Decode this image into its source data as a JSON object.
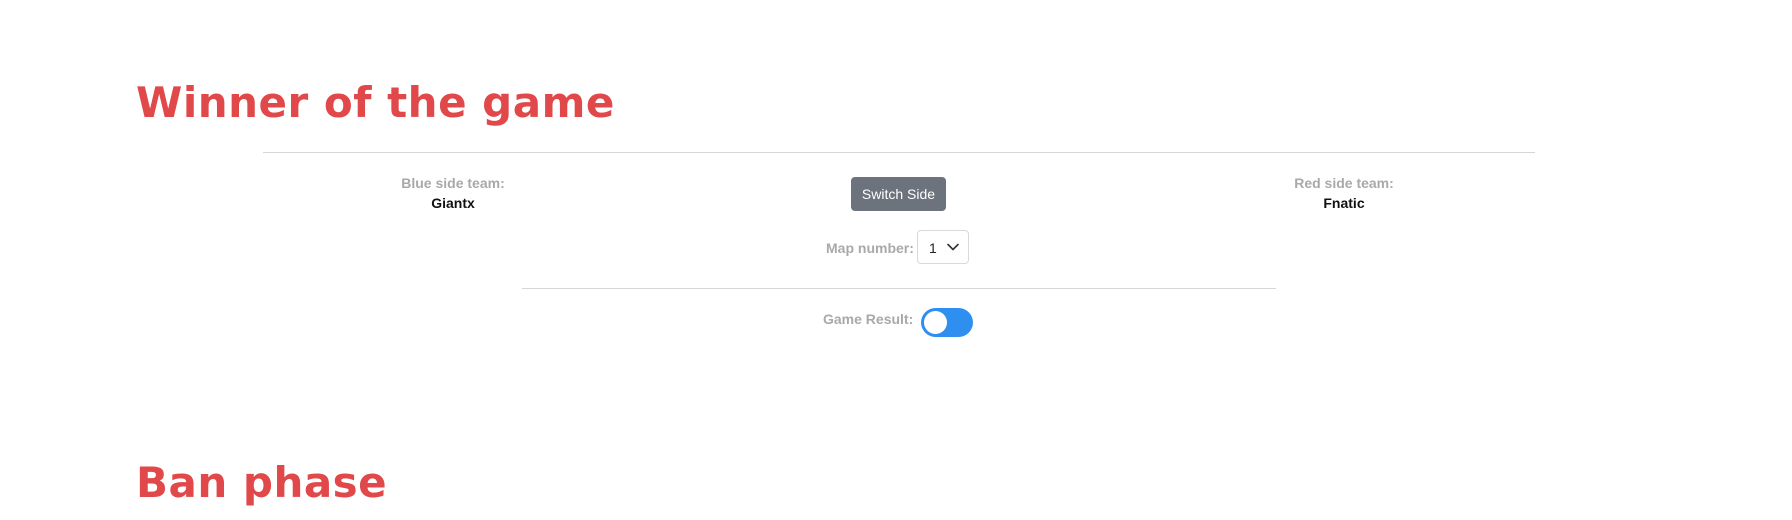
{
  "sections": {
    "winner_title": "Winner of the game",
    "ban_title": "Ban phase"
  },
  "teams": {
    "blue_label": "Blue side team:",
    "blue_name": "Giantx",
    "red_label": "Red side team:",
    "red_name": "Fnatic"
  },
  "controls": {
    "switch_side_label": "Switch Side",
    "map_number_label": "Map number:",
    "map_number_value": "1",
    "game_result_label": "Game Result:",
    "game_result_on": false
  },
  "icons": {
    "select_arrow": "chevron-down-icon"
  },
  "colors": {
    "title": "#e0484a",
    "switch_button": "#6c737c",
    "toggle": "#2f8ff0",
    "muted_label": "#a9a9a9"
  }
}
